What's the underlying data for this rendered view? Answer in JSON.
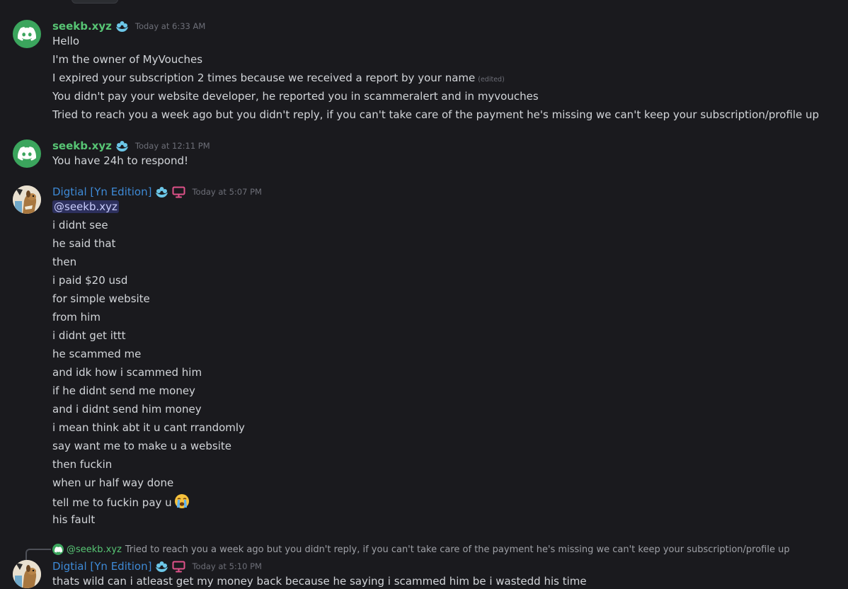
{
  "messages": [
    {
      "author": "seekb.xyz",
      "timestamp": "Today at 6:33 AM",
      "lines": [
        "Hello",
        "I'm the owner of MyVouches",
        "I expired your subscription 2 times because we received a report by your name",
        "You didn't pay your website developer, he reported you in scammeralert and in myvouches",
        "Tried to reach you a week ago but you didn't reply, if you can't take care of the payment he's missing we can't keep your subscription/profile up"
      ],
      "edited_label": "(edited)"
    },
    {
      "author": "seekb.xyz",
      "timestamp": "Today at 12:11 PM",
      "lines": [
        "You have 24h to respond!"
      ]
    },
    {
      "author": "Digtial [Yn Edition]",
      "timestamp": "Today at 5:07 PM",
      "mention": "@seekb.xyz",
      "lines": [
        "i didnt see",
        "he said that",
        "then",
        "i paid $20 usd",
        "for simple website",
        "from him",
        "i didnt get ittt",
        "he scammed me",
        "and idk how i scammed him",
        "if he didnt send me money",
        "and i didnt send him money",
        "i mean think abt it u cant rrandomly",
        "say want me to make u a website",
        "then fuckin",
        "when ur half way done",
        "tell me to fuckin pay u",
        "his fault"
      ]
    },
    {
      "author": "Digtial [Yn Edition]",
      "timestamp": "Today at 5:10 PM",
      "reply_author": "@seekb.xyz",
      "reply_text": "Tried to reach you a week ago but you didn't reply, if you can't take care of the payment he's missing we can't keep your subscription/profile up",
      "lines": [
        "thats wild can i atleast get my money back because he saying i scammed him be i wastedd his time"
      ]
    }
  ],
  "colors": {
    "background": "#1a1a1e",
    "green_name": "#57c574",
    "blue_name": "#3e8ad6",
    "mention_bg": "#3b3f75"
  },
  "icons": [
    "discord-logo-icon",
    "flower-badge-icon",
    "desktop-icon",
    "loudly-crying-emoji-icon"
  ]
}
